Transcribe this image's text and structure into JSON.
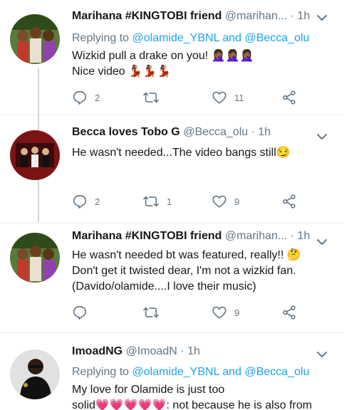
{
  "tweets": [
    {
      "name": "Marihana #KINGTOBI friend",
      "handle": "@marihan...",
      "dot": "·",
      "time": "1h",
      "reply_prefix": "Replying to ",
      "reply_users": "@olamide_YBNL and @Becca_olu",
      "text_lines": [
        "Wizkid pull a drake on you! 🤦🏾‍♀️🤦🏾‍♀️🤦🏾‍♀️",
        "Nice video 💃🏾💃🏾💃🏾"
      ],
      "reply_count": "2",
      "retweet_count": "",
      "like_count": "11",
      "avatar_icon": "group-photo-avatar"
    },
    {
      "name": "Becca loves Tobo G",
      "handle": "@Becca_olu",
      "dot": "·",
      "time": "1h",
      "text_lines": [
        "He wasn't needed...The video bangs still😏"
      ],
      "reply_count": "2",
      "retweet_count": "1",
      "like_count": "9",
      "avatar_icon": "group-poster-avatar"
    },
    {
      "name": "Marihana #KINGTOBI friend",
      "handle": "@marihan...",
      "dot": "·",
      "time": "1h",
      "text_lines": [
        "He wasn't needed bt was featured, really!! 🤔",
        "Don't get it twisted dear, I'm not a wizkid fan.",
        "(Davido/olamide....I love their music)"
      ],
      "reply_count": "",
      "retweet_count": "",
      "like_count": "9",
      "avatar_icon": "group-photo-avatar"
    },
    {
      "name": "ImoadNG",
      "handle": "@ImoadN",
      "dot": "·",
      "time": "1h",
      "reply_prefix": "Replying to ",
      "reply_users": "@olamide_YBNL and @Becca_olu",
      "text_lines": [
        "My love for Olamide is just too",
        "solid💗💗💗💗💗: not because he is also from"
      ],
      "avatar_icon": "man-portrait-avatar"
    }
  ],
  "colors": {
    "accent": "#1da1f2",
    "secondary_text": "#657786",
    "icon": "#657786",
    "divider": "#e6ecf0",
    "thread_line": "#ccd6dd"
  },
  "icons": {
    "reply": "reply-icon",
    "retweet": "retweet-icon",
    "like": "heart-icon",
    "share": "share-icon",
    "menu": "chevron-down-icon"
  }
}
